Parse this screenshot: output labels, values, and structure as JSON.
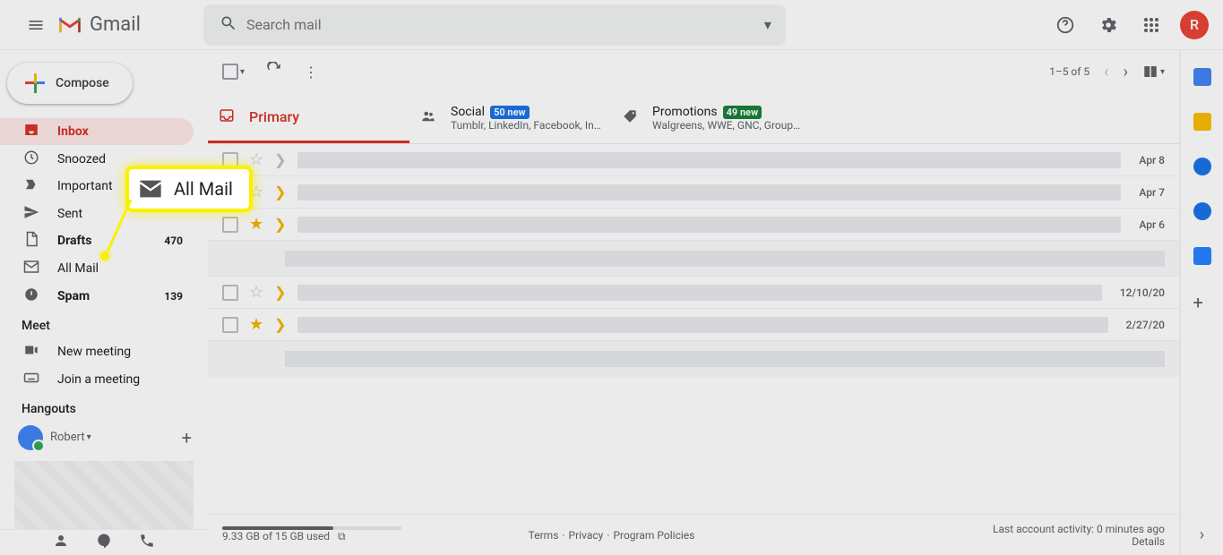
{
  "header": {
    "app_name": "Gmail",
    "search_placeholder": "Search mail",
    "avatar_initial": "R"
  },
  "sidebar": {
    "compose_label": "Compose",
    "items": [
      {
        "label": "Inbox",
        "active": true,
        "bold": true
      },
      {
        "label": "Snoozed"
      },
      {
        "label": "Important"
      },
      {
        "label": "Sent"
      },
      {
        "label": "Drafts",
        "count": "470",
        "bold": true
      },
      {
        "label": "All Mail"
      },
      {
        "label": "Spam",
        "count": "139",
        "bold": true
      }
    ],
    "meet_heading": "Meet",
    "meet_new": "New meeting",
    "meet_join": "Join a meeting",
    "hangouts_heading": "Hangouts",
    "hangouts_user": "Robert"
  },
  "toolbar": {
    "count_text": "1–5 of 5"
  },
  "tabs": {
    "primary": "Primary",
    "social": {
      "title": "Social",
      "badge": "50 new",
      "sub": "Tumblr, LinkedIn, Facebook, Ins…"
    },
    "promotions": {
      "title": "Promotions",
      "badge": "49 new",
      "sub": "Walgreens, WWE, GNC, Groupo…"
    }
  },
  "mail": {
    "dates": [
      "Apr 8",
      "Apr 7",
      "Apr 6",
      "12/10/20",
      "2/27/20"
    ]
  },
  "footer": {
    "storage": "9.33 GB of 15 GB used",
    "terms": "Terms",
    "privacy": "Privacy",
    "policies": "Program Policies",
    "activity": "Last account activity: 0 minutes ago",
    "details": "Details"
  },
  "callout": {
    "label": "All Mail"
  }
}
